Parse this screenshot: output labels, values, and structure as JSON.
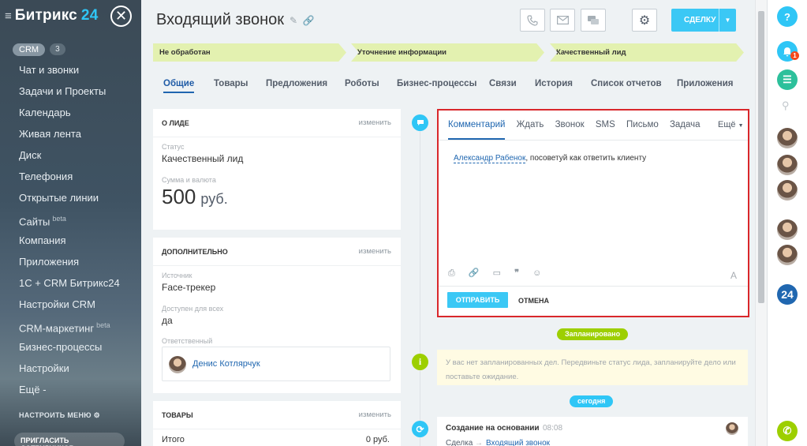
{
  "sidebar": {
    "brand": "Битрикс",
    "brand_num": "24",
    "crm_label": "CRM",
    "crm_count": "3",
    "items": [
      {
        "label": "Чат и звонки"
      },
      {
        "label": "Задачи и Проекты"
      },
      {
        "label": "Календарь"
      },
      {
        "label": "Живая лента"
      },
      {
        "label": "Диск"
      },
      {
        "label": "Телефония"
      },
      {
        "label": "Открытые линии"
      },
      {
        "label": "Сайты",
        "sup": "beta"
      },
      {
        "label": "Компания"
      },
      {
        "label": "Приложения"
      },
      {
        "label": "1С + CRM Битрикс24"
      },
      {
        "label": "Настройки CRM"
      },
      {
        "label": "CRM-маркетинг",
        "sup": "beta"
      },
      {
        "label": "Бизнес-процессы"
      },
      {
        "label": "Настройки"
      },
      {
        "label": "Ещё -"
      }
    ],
    "setup_menu": "НАСТРОИТЬ МЕНЮ",
    "invite": "ПРИГЛАСИТЬ СОТРУДНИКОВ +"
  },
  "header": {
    "title": "Входящий звонок",
    "deal_button": "СДЕЛКУ"
  },
  "stages": [
    "Не обработан",
    "Уточнение информации",
    "Качественный лид"
  ],
  "tabs": [
    "Общие",
    "Товары",
    "Предложения",
    "Роботы",
    "Бизнес-процессы",
    "Связи",
    "История",
    "Список отчетов",
    "Приложения"
  ],
  "about": {
    "title": "О ЛИДЕ",
    "edit": "изменить",
    "status_label": "Статус",
    "status_value": "Качественный лид",
    "sum_label": "Сумма и валюта",
    "sum_value": "500",
    "currency": "руб."
  },
  "extra": {
    "title": "ДОПОЛНИТЕЛЬНО",
    "edit": "изменить",
    "source_label": "Источник",
    "source_value": "Face-трекер",
    "avail_label": "Доступен для всех",
    "avail_value": "да",
    "resp_label": "Ответственный",
    "resp_name": "Денис Котлярчук"
  },
  "goods": {
    "title": "ТОВАРЫ",
    "edit": "изменить",
    "total_label": "Итого",
    "total_value": "0 руб."
  },
  "editor": {
    "tabs": [
      "Комментарий",
      "Ждать",
      "Звонок",
      "SMS",
      "Письмо",
      "Задача"
    ],
    "more": "Ещё",
    "mention": "Александр Рабенок",
    "text": ", посоветуй как ответить клиенту",
    "send": "ОТПРАВИТЬ",
    "cancel": "ОТМЕНА"
  },
  "timeline": {
    "planned": "Запланировано",
    "planned_note": "У вас нет запланированных дел. Передвиньте статус лида, запланируйте дело или поставьте ожидание.",
    "today": "сегодня",
    "event_title": "Создание на основании",
    "event_time": "08:08",
    "event_sub_a": "Сделка",
    "event_sub_b": "Входящий звонок"
  },
  "rightbar": {
    "help": "?",
    "bell_badge": "1",
    "b24": "24"
  },
  "colors": {
    "accent": "#3bc8f5",
    "stage": "#e3f1b0",
    "timeline_green": "#9dcf00",
    "link": "#2067b0",
    "highlight": "#d9272b"
  }
}
